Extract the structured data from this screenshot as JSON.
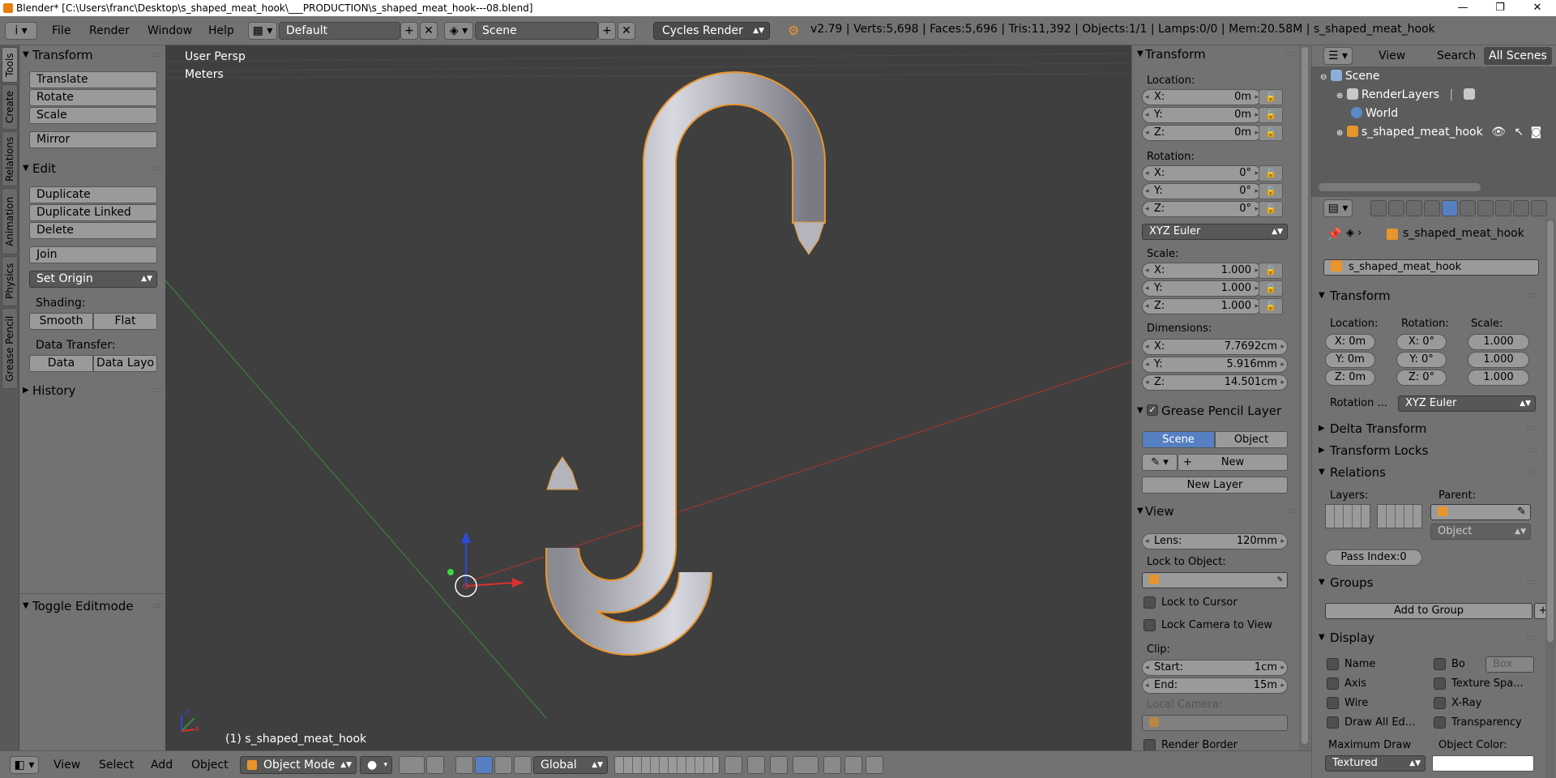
{
  "titlebar": {
    "title": "Blender* [C:\\Users\\franc\\Desktop\\s_shaped_meat_hook\\___PRODUCTION\\s_shaped_meat_hook---08.blend]",
    "minimize": "—",
    "maximize": "❐",
    "close": "✕"
  },
  "menubar": {
    "info_icon": "i",
    "menus": [
      "File",
      "Render",
      "Window",
      "Help"
    ],
    "layout": "Default",
    "scene": "Scene",
    "engine": "Cycles Render",
    "stats": "v2.79 | Verts:5,698 | Faces:5,696 | Tris:11,392 | Objects:1/1 | Lamps:0/0 | Mem:20.58M | s_shaped_meat_hook"
  },
  "tabs": [
    "Tools",
    "Create",
    "Relations",
    "Animation",
    "Physics",
    "Grease Pencil"
  ],
  "toolshelf": {
    "transform_header": "Transform",
    "transform_buttons": [
      "Translate",
      "Rotate",
      "Scale"
    ],
    "mirror": "Mirror",
    "edit_header": "Edit",
    "edit_buttons": [
      "Duplicate",
      "Duplicate Linked",
      "Delete"
    ],
    "join": "Join",
    "set_origin": "Set Origin",
    "shading_label": "Shading:",
    "smooth": "Smooth",
    "flat": "Flat",
    "data_transfer_label": "Data Transfer:",
    "data": "Data",
    "data_layo": "Data Layo",
    "history_header": "History",
    "toggle_editmode": "Toggle Editmode"
  },
  "viewport": {
    "view_name": "User Persp",
    "units": "Meters",
    "object_label": "(1) s_shaped_meat_hook",
    "axis_x": "x",
    "axis_z": "z",
    "colors": {
      "hook": "#a9a9b3",
      "outline": "#e8952c",
      "x_axis": "#b23030",
      "y_axis": "#3a8a3a"
    }
  },
  "npanel": {
    "transform_header": "Transform",
    "location_label": "Location:",
    "location": [
      {
        "k": "X:",
        "v": "0m"
      },
      {
        "k": "Y:",
        "v": "0m"
      },
      {
        "k": "Z:",
        "v": "0m"
      }
    ],
    "rotation_label": "Rotation:",
    "rotation": [
      {
        "k": "X:",
        "v": "0°"
      },
      {
        "k": "Y:",
        "v": "0°"
      },
      {
        "k": "Z:",
        "v": "0°"
      }
    ],
    "rotation_mode": "XYZ Euler",
    "scale_label": "Scale:",
    "scale": [
      {
        "k": "X:",
        "v": "1.000"
      },
      {
        "k": "Y:",
        "v": "1.000"
      },
      {
        "k": "Z:",
        "v": "1.000"
      }
    ],
    "dimensions_label": "Dimensions:",
    "dimensions": [
      {
        "k": "X:",
        "v": "7.7692cm"
      },
      {
        "k": "Y:",
        "v": "5.916mm"
      },
      {
        "k": "Z:",
        "v": "14.501cm"
      }
    ],
    "gp_header": "Grease Pencil Layer",
    "gp_scene": "Scene",
    "gp_object": "Object",
    "gp_new": "New",
    "gp_new_layer": "New Layer",
    "view_header": "View",
    "lens_k": "Lens:",
    "lens_v": "120mm",
    "lock_to_object": "Lock to Object:",
    "lock_to_cursor": "Lock to Cursor",
    "lock_camera": "Lock Camera to View",
    "clip_label": "Clip:",
    "clip_start_k": "Start:",
    "clip_start_v": "1cm",
    "clip_end_k": "End:",
    "clip_end_v": "15m",
    "local_camera": "Local Camera:",
    "render_border": "Render Border"
  },
  "outliner": {
    "tabs": [
      "View",
      "Search",
      "All Scenes"
    ],
    "rows": [
      {
        "name": "Scene"
      },
      {
        "name": "RenderLayers"
      },
      {
        "name": "World"
      },
      {
        "name": "s_shaped_meat_hook"
      }
    ]
  },
  "properties": {
    "breadcrumb": "s_shaped_meat_hook",
    "object_name": "s_shaped_meat_hook",
    "transform_header": "Transform",
    "location_label": "Location:",
    "rotation_label": "Rotation:",
    "scale_label": "Scale:",
    "loc": [
      "X: 0m",
      "Y: 0m",
      "Z: 0m"
    ],
    "rot": [
      "X:  0°",
      "Y:  0°",
      "Z:  0°"
    ],
    "scl": [
      "1.000",
      "1.000",
      "1.000"
    ],
    "rotation_mode_label": "Rotation ...",
    "rotation_mode": "XYZ Euler",
    "delta_transform": "Delta Transform",
    "transform_locks": "Transform Locks",
    "relations": "Relations",
    "layers_label": "Layers:",
    "parent_label": "Parent:",
    "parent_type": "Object",
    "pass_index": "Pass Index:0",
    "groups": "Groups",
    "add_to_group": "Add to Group",
    "display": "Display",
    "display_left": [
      "Name",
      "Axis",
      "Wire",
      "Draw All Ed..."
    ],
    "display_right": [
      "Bo",
      "Texture Spa...",
      "X-Ray",
      "Transparency"
    ],
    "bounds_type": "Box",
    "maximum_draw": "Maximum Draw",
    "object_color": "Object Color:",
    "draw_type": "Textured"
  },
  "bottombar": {
    "menus": [
      "View",
      "Select",
      "Add",
      "Object"
    ],
    "mode": "Object Mode",
    "orientation": "Global"
  }
}
